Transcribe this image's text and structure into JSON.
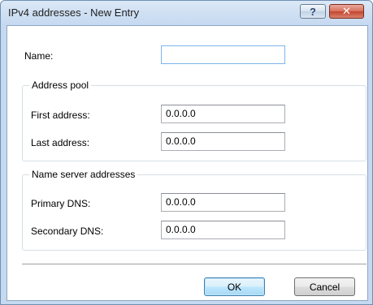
{
  "window": {
    "title": "IPv4 addresses - New Entry",
    "help_label": "?",
    "close_label": "✕"
  },
  "form": {
    "name_label": "Name:",
    "name_value": "",
    "address_pool": {
      "title": "Address pool",
      "first_label": "First address:",
      "first_value": "0.0.0.0",
      "last_label": "Last address:",
      "last_value": "0.0.0.0"
    },
    "name_servers": {
      "title": "Name server addresses",
      "primary_label": "Primary DNS:",
      "primary_value": "0.0.0.0",
      "secondary_label": "Secondary DNS:",
      "secondary_value": "0.0.0.0"
    }
  },
  "buttons": {
    "ok": "OK",
    "cancel": "Cancel"
  }
}
